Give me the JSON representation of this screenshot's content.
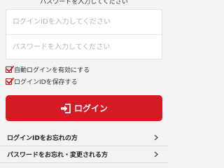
{
  "top_text": "パスワードを入力してください",
  "fields": {
    "login_id_placeholder": "ログインIDを入力してください",
    "password_placeholder": "パスワードを入力してください"
  },
  "checkboxes": [
    {
      "label": "自動ログインを有効にする",
      "checked": true
    },
    {
      "label": "ログインIDを保存する",
      "checked": true
    }
  ],
  "login_button": {
    "label": "ログイン",
    "icon": "login-icon"
  },
  "links": [
    {
      "label": "ログインIDをお忘れの方"
    },
    {
      "label": "パスワードをお忘れ・変更される方"
    }
  ],
  "colors": {
    "accent": "#d41a22",
    "background": "#f3f3f3"
  }
}
